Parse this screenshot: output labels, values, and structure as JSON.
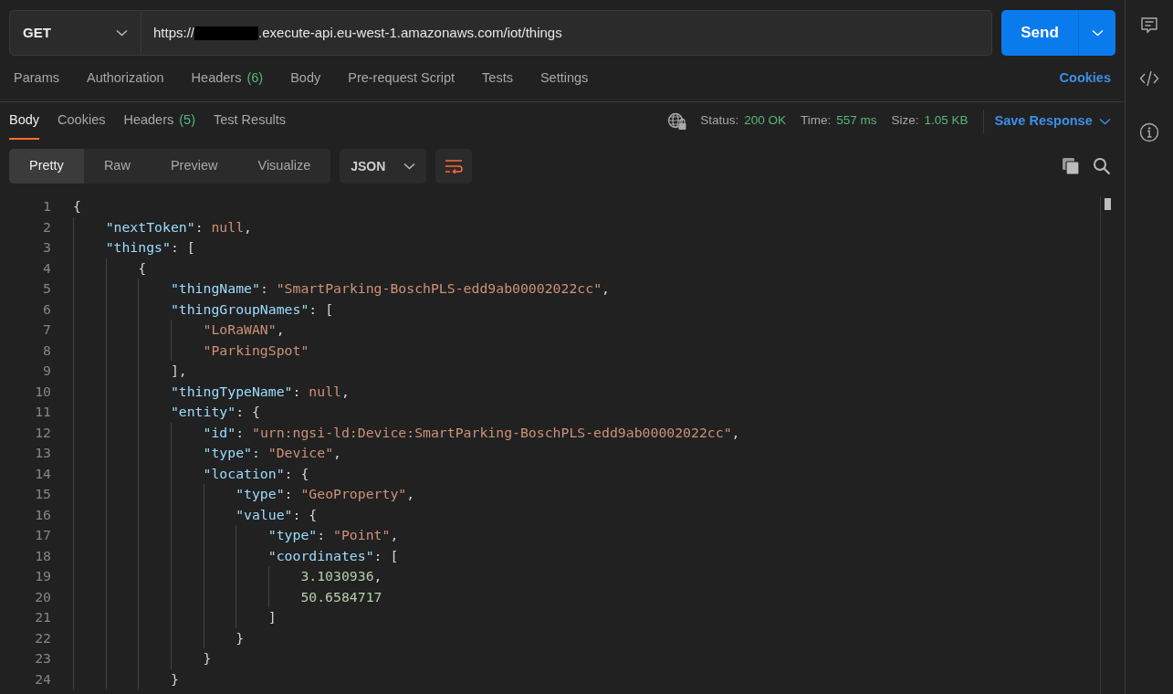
{
  "request": {
    "method": "GET",
    "url_start": "https://",
    "redacted": true,
    "url_end": ".execute-api.eu-west-1.amazonaws.com/iot/things",
    "send_label": "Send"
  },
  "request_tabs": [
    {
      "label": "Params",
      "selected": false
    },
    {
      "label": "Authorization",
      "selected": false
    },
    {
      "label": "Headers",
      "count": "(6)",
      "selected": false
    },
    {
      "label": "Body",
      "selected": false
    },
    {
      "label": "Pre-request Script",
      "selected": false
    },
    {
      "label": "Tests",
      "selected": false
    },
    {
      "label": "Settings",
      "selected": false
    }
  ],
  "cookies_link": "Cookies",
  "response_tabs": [
    {
      "label": "Body",
      "selected": true
    },
    {
      "label": "Cookies",
      "selected": false
    },
    {
      "label": "Headers",
      "count": "(5)",
      "selected": false
    },
    {
      "label": "Test Results",
      "selected": false
    }
  ],
  "response_meta": [
    {
      "label": "Status:",
      "value": "200 OK"
    },
    {
      "label": "Time:",
      "value": "557 ms"
    },
    {
      "label": "Size:",
      "value": "1.05 KB"
    }
  ],
  "save_response": "Save Response",
  "view_modes": [
    {
      "label": "Pretty",
      "selected": true
    },
    {
      "label": "Raw",
      "selected": false
    },
    {
      "label": "Preview",
      "selected": false
    },
    {
      "label": "Visualize",
      "selected": false
    }
  ],
  "format": "JSON",
  "code_lines": [
    {
      "number": "1",
      "tokens": [
        {
          "kind": "punct",
          "text": "{"
        }
      ],
      "children": [
        {
          "number": "2",
          "tokens": [
            {
              "kind": "key",
              "text": "\"nextToken\""
            },
            {
              "kind": "punct",
              "text": ": "
            },
            {
              "kind": "null",
              "text": "null"
            },
            {
              "kind": "punct",
              "text": ","
            }
          ]
        },
        {
          "number": "3",
          "tokens": [
            {
              "kind": "key",
              "text": "\"things\""
            },
            {
              "kind": "punct",
              "text": ": ["
            }
          ],
          "children": [
            {
              "number": "4",
              "tokens": [
                {
                  "kind": "punct",
                  "text": "{"
                }
              ],
              "children": [
                {
                  "number": "5",
                  "tokens": [
                    {
                      "kind": "key",
                      "text": "\"thingName\""
                    },
                    {
                      "kind": "punct",
                      "text": ": "
                    },
                    {
                      "kind": "string",
                      "text": "\"SmartParking-BoschPLS-edd9ab00002022cc\""
                    },
                    {
                      "kind": "punct",
                      "text": ","
                    }
                  ]
                },
                {
                  "number": "6",
                  "tokens": [
                    {
                      "kind": "key",
                      "text": "\"thingGroupNames\""
                    },
                    {
                      "kind": "punct",
                      "text": ": ["
                    }
                  ],
                  "children": [
                    {
                      "number": "7",
                      "tokens": [
                        {
                          "kind": "string",
                          "text": "\"LoRaWAN\""
                        },
                        {
                          "kind": "punct",
                          "text": ","
                        }
                      ]
                    },
                    {
                      "number": "8",
                      "tokens": [
                        {
                          "kind": "string",
                          "text": "\"ParkingSpot\""
                        }
                      ]
                    }
                  ]
                },
                {
                  "number": "9",
                  "tokens": [
                    {
                      "kind": "punct",
                      "text": "],"
                    }
                  ]
                },
                {
                  "number": "10",
                  "tokens": [
                    {
                      "kind": "key",
                      "text": "\"thingTypeName\""
                    },
                    {
                      "kind": "punct",
                      "text": ": "
                    },
                    {
                      "kind": "null",
                      "text": "null"
                    },
                    {
                      "kind": "punct",
                      "text": ","
                    }
                  ]
                },
                {
                  "number": "11",
                  "tokens": [
                    {
                      "kind": "key",
                      "text": "\"entity\""
                    },
                    {
                      "kind": "punct",
                      "text": ": {"
                    }
                  ],
                  "children": [
                    {
                      "number": "12",
                      "tokens": [
                        {
                          "kind": "key",
                          "text": "\"id\""
                        },
                        {
                          "kind": "punct",
                          "text": ": "
                        },
                        {
                          "kind": "string",
                          "text": "\"urn:ngsi-ld:Device:SmartParking-BoschPLS-edd9ab00002022cc\""
                        },
                        {
                          "kind": "punct",
                          "text": ","
                        }
                      ]
                    },
                    {
                      "number": "13",
                      "tokens": [
                        {
                          "kind": "key",
                          "text": "\"type\""
                        },
                        {
                          "kind": "punct",
                          "text": ": "
                        },
                        {
                          "kind": "string",
                          "text": "\"Device\""
                        },
                        {
                          "kind": "punct",
                          "text": ","
                        }
                      ]
                    },
                    {
                      "number": "14",
                      "tokens": [
                        {
                          "kind": "key",
                          "text": "\"location\""
                        },
                        {
                          "kind": "punct",
                          "text": ": {"
                        }
                      ],
                      "children": [
                        {
                          "number": "15",
                          "tokens": [
                            {
                              "kind": "key",
                              "text": "\"type\""
                            },
                            {
                              "kind": "punct",
                              "text": ": "
                            },
                            {
                              "kind": "string",
                              "text": "\"GeoProperty\""
                            },
                            {
                              "kind": "punct",
                              "text": ","
                            }
                          ]
                        },
                        {
                          "number": "16",
                          "tokens": [
                            {
                              "kind": "key",
                              "text": "\"value\""
                            },
                            {
                              "kind": "punct",
                              "text": ": {"
                            }
                          ],
                          "children": [
                            {
                              "number": "17",
                              "tokens": [
                                {
                                  "kind": "key",
                                  "text": "\"type\""
                                },
                                {
                                  "kind": "punct",
                                  "text": ": "
                                },
                                {
                                  "kind": "string",
                                  "text": "\"Point\""
                                },
                                {
                                  "kind": "punct",
                                  "text": ","
                                }
                              ]
                            },
                            {
                              "number": "18",
                              "tokens": [
                                {
                                  "kind": "key",
                                  "text": "\"coordinates\""
                                },
                                {
                                  "kind": "punct",
                                  "text": ": ["
                                }
                              ],
                              "children": [
                                {
                                  "number": "19",
                                  "tokens": [
                                    {
                                      "kind": "number",
                                      "text": "3.1030936"
                                    },
                                    {
                                      "kind": "punct",
                                      "text": ","
                                    }
                                  ]
                                },
                                {
                                  "number": "20",
                                  "tokens": [
                                    {
                                      "kind": "number",
                                      "text": "50.6584717"
                                    }
                                  ]
                                }
                              ]
                            },
                            {
                              "number": "21",
                              "tokens": [
                                {
                                  "kind": "punct",
                                  "text": "]"
                                }
                              ]
                            }
                          ]
                        },
                        {
                          "number": "22",
                          "tokens": [
                            {
                              "kind": "punct",
                              "text": "}"
                            }
                          ]
                        }
                      ]
                    },
                    {
                      "number": "23",
                      "tokens": [
                        {
                          "kind": "punct",
                          "text": "}"
                        }
                      ]
                    }
                  ]
                },
                {
                  "number": "24",
                  "tokens": [
                    {
                      "kind": "punct",
                      "text": "}"
                    }
                  ]
                }
              ]
            }
          ]
        }
      ]
    }
  ]
}
